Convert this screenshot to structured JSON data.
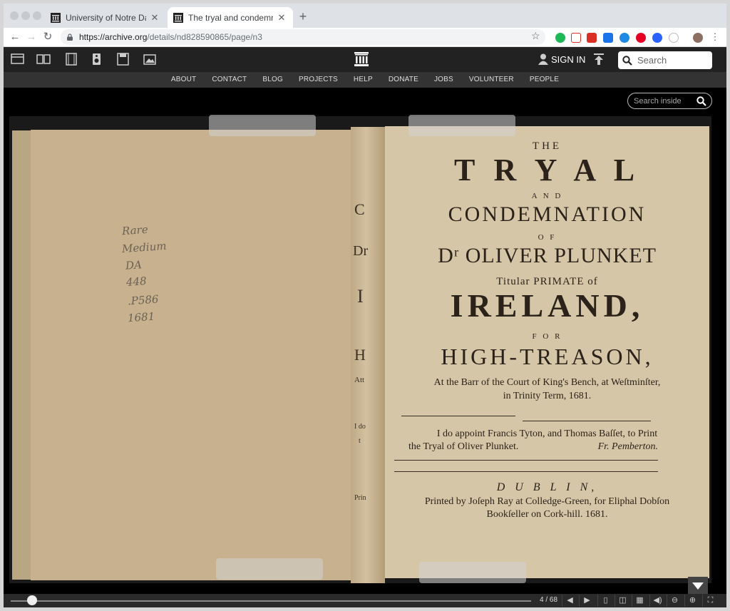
{
  "browser": {
    "tabs": [
      {
        "title": "University of Notre Dame Hesb",
        "active": false
      },
      {
        "title": "The tryal and condemnation of",
        "active": true
      }
    ],
    "new_tab": "+",
    "url_host": "https://archive.org",
    "url_path": "/details/nd828590865/page/n3"
  },
  "ia_header": {
    "signin": "SIGN IN",
    "search_placeholder": "Search",
    "nav": [
      "ABOUT",
      "CONTACT",
      "BLOG",
      "PROJECTS",
      "HELP",
      "DONATE",
      "JOBS",
      "VOLUNTEER",
      "PEOPLE"
    ]
  },
  "reader": {
    "search_inside_placeholder": "Search inside",
    "page_indicator": "4 / 68",
    "handwritten": [
      "Rare",
      "Medium",
      "DA",
      "448",
      ".P586",
      "1681"
    ],
    "spine_letters": [
      "C",
      "Dr",
      "I",
      "H",
      "Att",
      "I do",
      "t",
      "Prin"
    ],
    "title_page": {
      "the": "THE",
      "tryal": "T R Y A L",
      "and": "A N D",
      "condemnation": "CONDEMNATION",
      "of1": "O F",
      "name": "Dʳ OLIVER  PLUNKET",
      "titular": "Titular PRIMATE of",
      "ireland": "IRELAND,",
      "for": "F O R",
      "treason": "HIGH-TREASON,",
      "court_line1": "At the Barr of the Court of King's Bench, at Weſtminſter,",
      "court_line2": "in Trinity Term, 1681.",
      "appoint_line1": "I do appoint Francis Tyton, and Thomas Baſſet, to Print",
      "appoint_line2a": "the Tryal of Oliver Plunket.",
      "appoint_line2b": "Fr. Pemberton.",
      "dublin": "D U B L I N,",
      "printed_line1": "Printed by Joſeph Ray at Colledge-Green, for Eliphal Dobſon",
      "printed_line2": "Bookſeller on Cork-hill. 1681."
    }
  }
}
